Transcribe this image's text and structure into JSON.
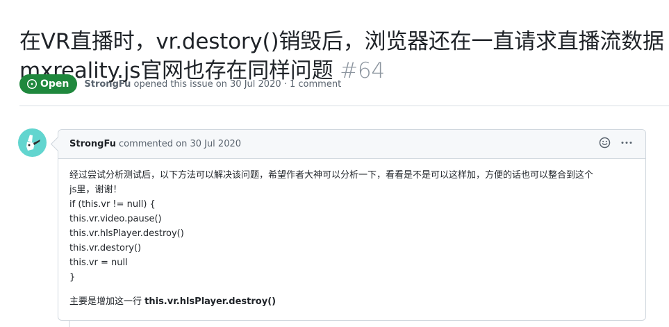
{
  "issue": {
    "title_text": "在VR直播时，vr.destory()销毁后，浏览器还在一直请求直播流数据 mxreality.js官网也存在同样问题",
    "number": "#64",
    "state": "Open",
    "author": "StrongFu",
    "meta_suffix": "opened this issue on 30 Jul 2020 · 1 comment"
  },
  "comment": {
    "author": "StrongFu",
    "action": "commented on 30 Jul 2020",
    "icons": [
      "smiley-icon",
      "kebab-icon"
    ],
    "body_lines": [
      "经过尝试分析测试后，以下方法可以解决该问题，希望作者大神可以分析一下，看看是不是可以这样加，方便的话也可以整合到这个",
      "js里，谢谢！",
      "if (this.vr != null) {",
      "this.vr.video.pause()",
      "this.vr.hlsPlayer.destroy()",
      "this.vr.destory()",
      "this.vr = null",
      "}"
    ],
    "footer_prefix": "主要是增加这一行 ",
    "footer_code": "this.vr.hlsPlayer.destroy()"
  },
  "colors": {
    "open_green": "#1f883d",
    "avatar_bg": "#62d5cf"
  }
}
